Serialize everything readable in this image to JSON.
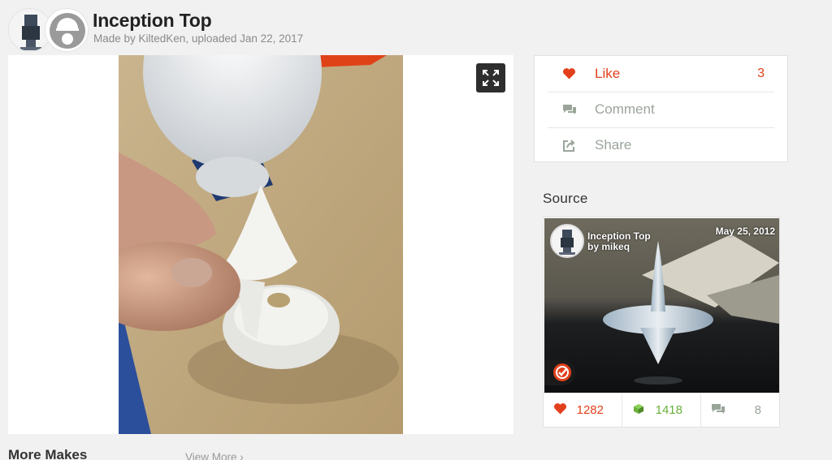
{
  "header": {
    "title": "Inception Top",
    "byline": "Made by KiltedKen, uploaded Jan 22, 2017"
  },
  "actions": {
    "like": {
      "label": "Like",
      "count": "3"
    },
    "comment": {
      "label": "Comment"
    },
    "share": {
      "label": "Share"
    }
  },
  "source": {
    "heading": "Source",
    "title": "Inception Top",
    "author": "by mikeq",
    "date": "May 25, 2012",
    "stats": {
      "likes": "1282",
      "collects": "1418",
      "comments": "8"
    }
  },
  "more_makes": {
    "heading": "More Makes",
    "view_more": "View More"
  },
  "colors": {
    "accent_red": "#e2401c",
    "collect_green": "#6ab03a",
    "muted": "#9aa59a"
  },
  "icons": {
    "like": "heart-icon",
    "comment": "comment-icon",
    "share": "share-icon",
    "expand": "expand-icon",
    "featured": "featured-badge-icon",
    "collect": "collect-icon",
    "view_more": "chevron-right-icon"
  }
}
